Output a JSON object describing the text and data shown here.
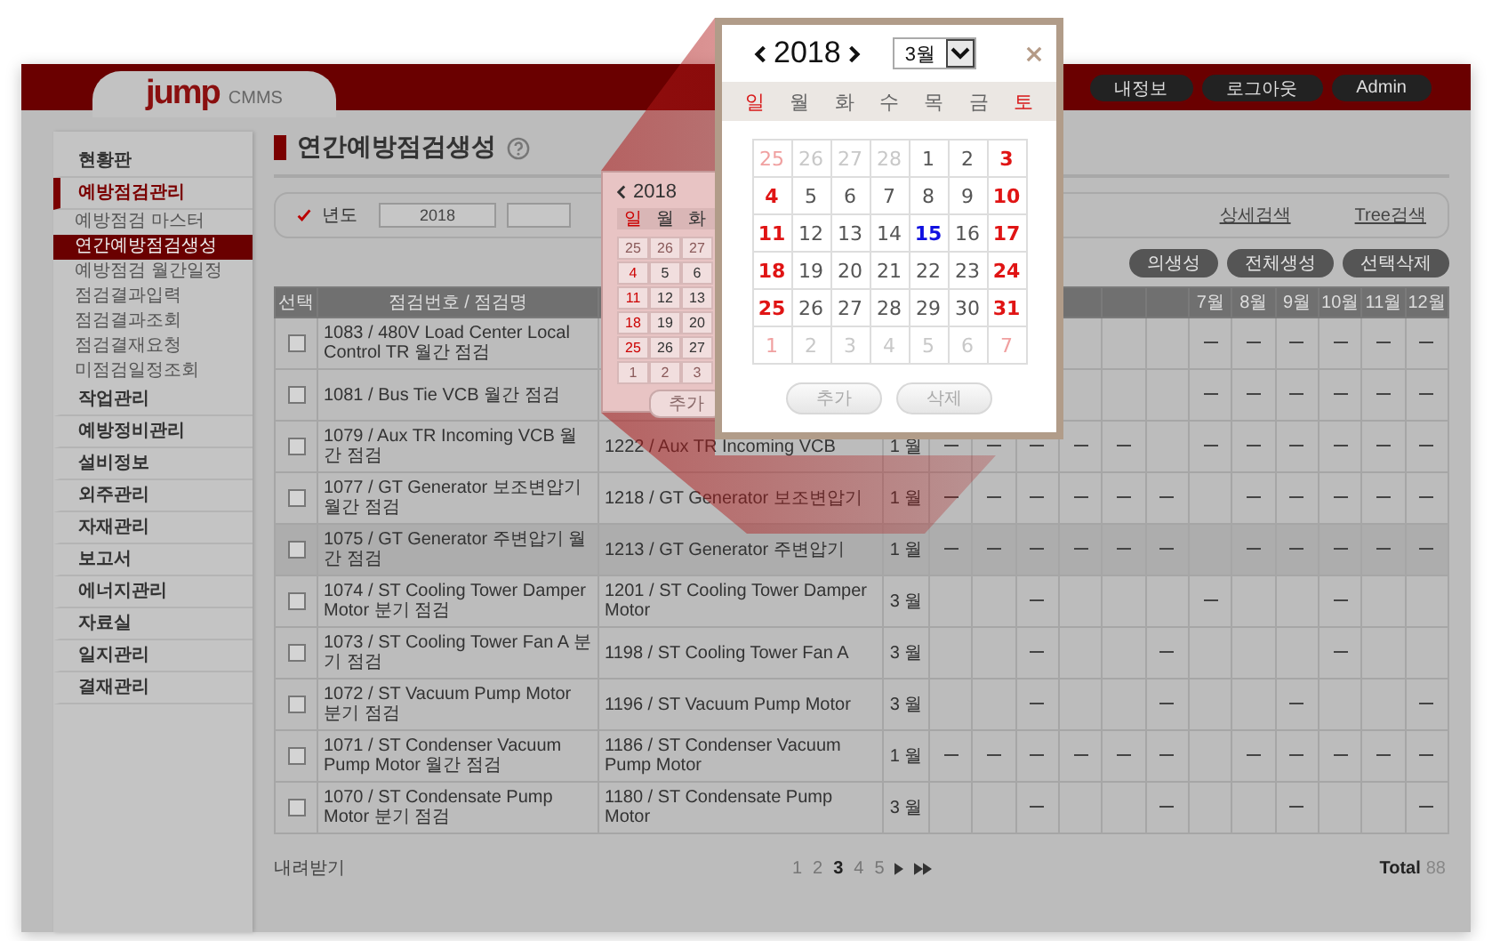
{
  "header": {
    "logo": "jump",
    "product": "CMMS",
    "buttons": [
      "내정보",
      "로그아웃",
      "Admin"
    ]
  },
  "sidebar": {
    "items": [
      {
        "label": "현황판",
        "selected": false
      },
      {
        "label": "예방점검관리",
        "selected": true,
        "children": [
          {
            "label": "예방점검 마스터",
            "selected": false
          },
          {
            "label": "연간예방점검생성",
            "selected": true
          },
          {
            "label": "예방점검 월간일정",
            "selected": false
          },
          {
            "label": "점검결과입력",
            "selected": false
          },
          {
            "label": "점검결과조회",
            "selected": false
          },
          {
            "label": "점검결재요청",
            "selected": false
          },
          {
            "label": "미점검일정조회",
            "selected": false
          }
        ]
      },
      {
        "label": "작업관리",
        "selected": false
      },
      {
        "label": "예방정비관리",
        "selected": false
      },
      {
        "label": "설비정보",
        "selected": false
      },
      {
        "label": "외주관리",
        "selected": false
      },
      {
        "label": "자재관리",
        "selected": false
      },
      {
        "label": "보고서",
        "selected": false
      },
      {
        "label": "에너지관리",
        "selected": false
      },
      {
        "label": "자료실",
        "selected": false
      },
      {
        "label": "일지관리",
        "selected": false
      },
      {
        "label": "결재관리",
        "selected": false
      }
    ]
  },
  "page_title": "연간예방점검생성",
  "search": {
    "label": "년도",
    "year_value": "2018",
    "links": [
      "상세검색",
      "Tree검색"
    ]
  },
  "actions": [
    "의생성",
    "전체생성",
    "선택삭제"
  ],
  "table": {
    "columns": {
      "select": "선택",
      "name": "점검번호 / 점검명",
      "month_headers": [
        "7월",
        "8월",
        "9월",
        "10월",
        "11월",
        "12월"
      ]
    },
    "rows": [
      {
        "checked": false,
        "highlighted": false,
        "name": "1083 / 480V Load Center Local Control TR 월간 점검",
        "months": [
          false,
          false,
          false,
          false,
          false,
          false,
          true,
          true,
          true,
          true,
          true,
          true
        ]
      },
      {
        "checked": false,
        "highlighted": false,
        "name": "1081 / Bus Tie VCB 월간 점검",
        "months": [
          false,
          false,
          false,
          false,
          false,
          false,
          true,
          true,
          true,
          true,
          true,
          true
        ]
      },
      {
        "checked": false,
        "highlighted": false,
        "name": "1079 / Aux TR Incoming VCB 월간 점검",
        "equipment": "1222 / Aux TR Incoming VCB",
        "cycle": "1 월",
        "months": [
          true,
          true,
          true,
          true,
          true,
          false,
          true,
          true,
          true,
          true,
          true,
          true
        ]
      },
      {
        "checked": false,
        "highlighted": false,
        "name": "1077 / GT Generator 보조변압기 월간 점검",
        "equipment": "1218 / GT Generator 보조변압기",
        "cycle": "1 월",
        "months": [
          true,
          true,
          true,
          true,
          true,
          true,
          false,
          true,
          true,
          true,
          true,
          true
        ]
      },
      {
        "checked": false,
        "highlighted": true,
        "name": "1075 / GT Generator 주변압기 월간 점검",
        "equipment": "1213 / GT Generator 주변압기",
        "cycle": "1 월",
        "months": [
          true,
          true,
          true,
          true,
          true,
          true,
          false,
          true,
          true,
          true,
          true,
          true
        ]
      },
      {
        "checked": false,
        "highlighted": false,
        "name": "1074 / ST Cooling Tower Damper Motor 분기 점검",
        "equipment": "1201 / ST Cooling Tower Damper Motor",
        "cycle": "3 월",
        "months": [
          false,
          false,
          true,
          false,
          false,
          false,
          true,
          false,
          false,
          true,
          false,
          false
        ]
      },
      {
        "checked": false,
        "highlighted": false,
        "name": "1073 / ST Cooling Tower Fan A 분기 점검",
        "equipment": "1198 / ST Cooling Tower Fan A",
        "cycle": "3 월",
        "months": [
          false,
          false,
          true,
          false,
          false,
          true,
          false,
          false,
          false,
          true,
          false,
          false
        ]
      },
      {
        "checked": false,
        "highlighted": false,
        "name": "1072 / ST Vacuum Pump Motor 분기 점검",
        "equipment": "1196 / ST Vacuum Pump Motor",
        "cycle": "3 월",
        "months": [
          false,
          false,
          true,
          false,
          false,
          true,
          false,
          false,
          true,
          false,
          false,
          true
        ]
      },
      {
        "checked": false,
        "highlighted": false,
        "name": "1071 / ST Condenser Vacuum Pump Motor 월간 점검",
        "equipment": "1186 / ST Condenser Vacuum Pump Motor",
        "cycle": "1 월",
        "months": [
          true,
          true,
          true,
          true,
          true,
          true,
          false,
          true,
          true,
          true,
          true,
          true
        ]
      },
      {
        "checked": false,
        "highlighted": false,
        "name": "1070 / ST Condensate Pump Motor 분기 점검",
        "equipment": "1180 / ST Condensate Pump Motor",
        "cycle": "3 월",
        "months": [
          false,
          false,
          true,
          false,
          false,
          true,
          false,
          false,
          true,
          false,
          false,
          true
        ]
      }
    ]
  },
  "footer": {
    "download": "내려받기",
    "pages": [
      {
        "label": "1",
        "selected": false
      },
      {
        "label": "2",
        "selected": false
      },
      {
        "label": "3",
        "selected": true
      },
      {
        "label": "4",
        "selected": false
      },
      {
        "label": "5",
        "selected": false
      }
    ],
    "total_label": "Total",
    "total": "88"
  },
  "mini_calendar": {
    "year": "2018",
    "weekdays": [
      "일",
      "월",
      "화"
    ],
    "weeks": [
      [
        {
          "label": "25",
          "outside_month": true
        },
        {
          "label": "26",
          "outside_month": true
        },
        {
          "label": "27",
          "outside_month": true
        }
      ],
      [
        {
          "label": "4",
          "outside_month": false
        },
        {
          "label": "5",
          "outside_month": false
        },
        {
          "label": "6",
          "outside_month": false
        }
      ],
      [
        {
          "label": "11",
          "outside_month": false
        },
        {
          "label": "12",
          "outside_month": false
        },
        {
          "label": "13",
          "outside_month": false
        }
      ],
      [
        {
          "label": "18",
          "outside_month": false
        },
        {
          "label": "19",
          "outside_month": false
        },
        {
          "label": "20",
          "outside_month": false
        }
      ],
      [
        {
          "label": "25",
          "outside_month": false
        },
        {
          "label": "26",
          "outside_month": false
        },
        {
          "label": "27",
          "outside_month": false
        }
      ],
      [
        {
          "label": "1",
          "outside_month": true
        },
        {
          "label": "2",
          "outside_month": true
        },
        {
          "label": "3",
          "outside_month": true
        }
      ]
    ],
    "button": "추가"
  },
  "popup": {
    "year": "2018",
    "month": "3월",
    "weekdays": [
      "일",
      "월",
      "화",
      "수",
      "목",
      "금",
      "토"
    ],
    "weeks": [
      [
        {
          "label": "25",
          "outside_month": true,
          "today": false
        },
        {
          "label": "26",
          "outside_month": true,
          "today": false
        },
        {
          "label": "27",
          "outside_month": true,
          "today": false
        },
        {
          "label": "28",
          "outside_month": true,
          "today": false
        },
        {
          "label": "1",
          "outside_month": false,
          "today": false
        },
        {
          "label": "2",
          "outside_month": false,
          "today": false
        },
        {
          "label": "3",
          "outside_month": false,
          "today": false
        }
      ],
      [
        {
          "label": "4",
          "outside_month": false,
          "today": false
        },
        {
          "label": "5",
          "outside_month": false,
          "today": false
        },
        {
          "label": "6",
          "outside_month": false,
          "today": false
        },
        {
          "label": "7",
          "outside_month": false,
          "today": false
        },
        {
          "label": "8",
          "outside_month": false,
          "today": false
        },
        {
          "label": "9",
          "outside_month": false,
          "today": false
        },
        {
          "label": "10",
          "outside_month": false,
          "today": false
        }
      ],
      [
        {
          "label": "11",
          "outside_month": false,
          "today": false
        },
        {
          "label": "12",
          "outside_month": false,
          "today": false
        },
        {
          "label": "13",
          "outside_month": false,
          "today": false
        },
        {
          "label": "14",
          "outside_month": false,
          "today": false
        },
        {
          "label": "15",
          "outside_month": false,
          "today": true
        },
        {
          "label": "16",
          "outside_month": false,
          "today": false
        },
        {
          "label": "17",
          "outside_month": false,
          "today": false
        }
      ],
      [
        {
          "label": "18",
          "outside_month": false,
          "today": false
        },
        {
          "label": "19",
          "outside_month": false,
          "today": false
        },
        {
          "label": "20",
          "outside_month": false,
          "today": false
        },
        {
          "label": "21",
          "outside_month": false,
          "today": false
        },
        {
          "label": "22",
          "outside_month": false,
          "today": false
        },
        {
          "label": "23",
          "outside_month": false,
          "today": false
        },
        {
          "label": "24",
          "outside_month": false,
          "today": false
        }
      ],
      [
        {
          "label": "25",
          "outside_month": false,
          "today": false
        },
        {
          "label": "26",
          "outside_month": false,
          "today": false
        },
        {
          "label": "27",
          "outside_month": false,
          "today": false
        },
        {
          "label": "28",
          "outside_month": false,
          "today": false
        },
        {
          "label": "29",
          "outside_month": false,
          "today": false
        },
        {
          "label": "30",
          "outside_month": false,
          "today": false
        },
        {
          "label": "31",
          "outside_month": false,
          "today": false
        }
      ],
      [
        {
          "label": "1",
          "outside_month": true,
          "today": false
        },
        {
          "label": "2",
          "outside_month": true,
          "today": false
        },
        {
          "label": "3",
          "outside_month": true,
          "today": false
        },
        {
          "label": "4",
          "outside_month": true,
          "today": false
        },
        {
          "label": "5",
          "outside_month": true,
          "today": false
        },
        {
          "label": "6",
          "outside_month": true,
          "today": false
        },
        {
          "label": "7",
          "outside_month": true,
          "today": false
        }
      ]
    ],
    "buttons": [
      {
        "label": "추가",
        "disabled": true
      },
      {
        "label": "삭제",
        "disabled": true
      }
    ]
  }
}
